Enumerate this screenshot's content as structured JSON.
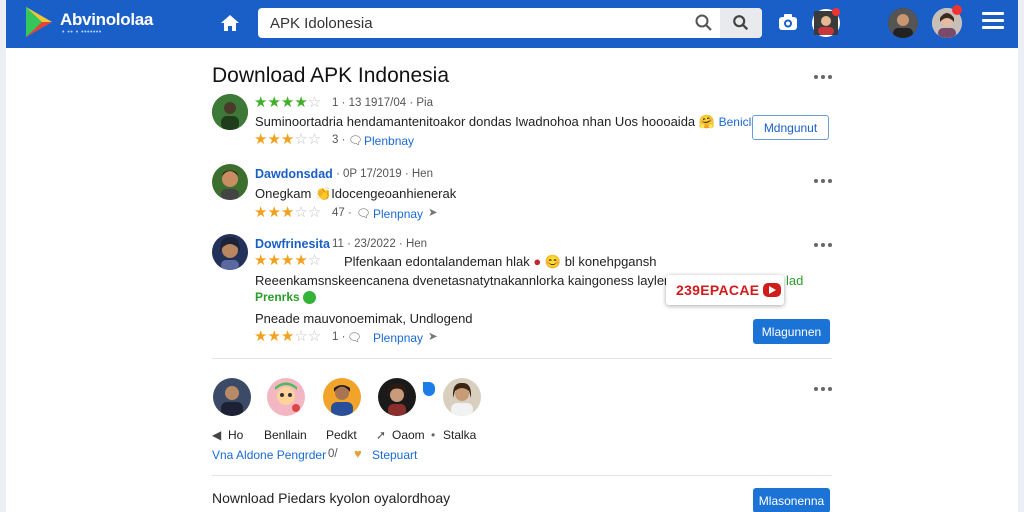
{
  "topbar": {
    "brand": "Abvinololaa",
    "brand_sub": "• •• • •••••••",
    "search_value": "APK Idolonesia"
  },
  "page": {
    "title": "Download APK Indonesia"
  },
  "reviews": [
    {
      "rating_meta": "1 · 13 1917/04 · Pia",
      "text": "Suminoortadria hendamantenitoakor dondas Iwadnohoa nhan Uos hoooaida",
      "emoji": "🤗",
      "tail_link": "Beniclan",
      "action_label": "Mdngunut",
      "sub_count": "3 ·",
      "sub_link": "Plenbnay"
    },
    {
      "author": "Dawdonsdad",
      "date": "· 0P 17/2019 · Hen",
      "text": "Onegkam",
      "emoji": "👏",
      "text_tail": "Idocengeoanhienerak",
      "sub_count": "47 ·",
      "sub_link": "Plenpnay"
    },
    {
      "author": "Dowfrinesita",
      "date": "11 · 23/2022 · Hen",
      "line1": "Plfenkaan edontalandeman hlak",
      "line1_tail": "bl konehpgansh",
      "line2": "Reeenkamsnskeencanena dvenetasnatytnakannlorka kaingoness laylenar",
      "line2_end": "lad",
      "line3": "Prenrks",
      "line4": "Pneade mauvonoemimak, Undlogend",
      "action_label": "Mlagunnen",
      "sub_count": "1 ·",
      "sub_link": "Plenpnay"
    }
  ],
  "badge": {
    "text": "239EPACAE"
  },
  "people": {
    "names": [
      "Ho",
      "Benllain",
      "Pedkt",
      "Oaom",
      "Stalka"
    ],
    "footer_link": "Vna Aldone Pengrder",
    "footer_sep": "0/",
    "footer_action": "Stepuart"
  },
  "bottom": {
    "text": "Nownload Piedars kyolon oyalordhoay",
    "action_label": "Mlasonenna"
  }
}
